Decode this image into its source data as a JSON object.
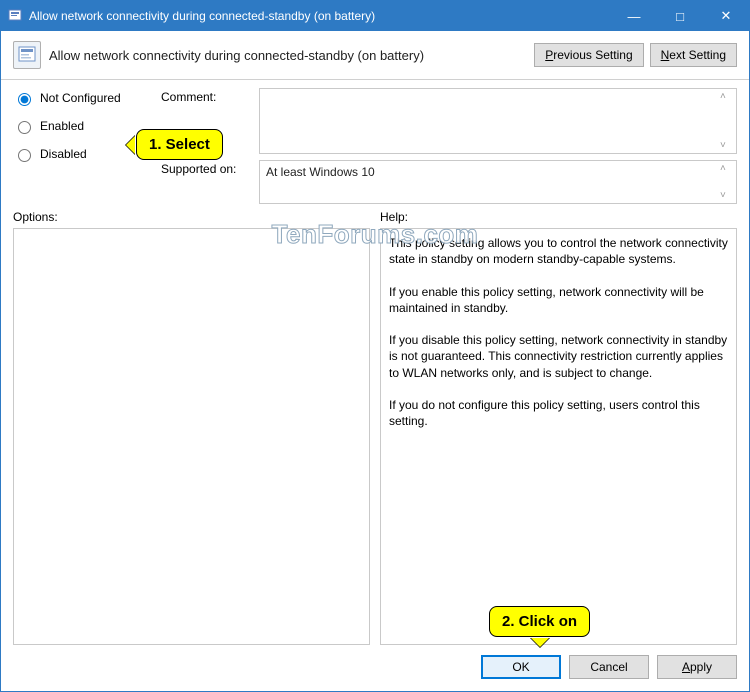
{
  "window": {
    "title": "Allow network connectivity during connected-standby (on battery)",
    "controls": {
      "min": "—",
      "max": "□",
      "close": "✕"
    }
  },
  "header": {
    "title": "Allow network connectivity during connected-standby (on battery)",
    "prev": "Previous Setting",
    "next": "Next Setting"
  },
  "radios": {
    "not_configured": "Not Configured",
    "enabled": "Enabled",
    "disabled": "Disabled"
  },
  "labels": {
    "comment": "Comment:",
    "supported": "Supported on:",
    "options": "Options:",
    "help": "Help:"
  },
  "supported_value": "At least Windows 10",
  "help_text": "This policy setting allows you to control the network connectivity state in standby on modern standby-capable systems.\n\nIf you enable this policy setting, network connectivity will be maintained in standby.\n\nIf you disable this policy setting, network connectivity in standby is not guaranteed. This connectivity restriction currently applies to WLAN networks only, and is subject to change.\n\nIf you do not configure this policy setting, users control this setting.",
  "footer": {
    "ok": "OK",
    "cancel": "Cancel",
    "apply": "Apply"
  },
  "annotations": {
    "select": "1. Select",
    "click": "2. Click on"
  },
  "watermark": "TenForums.com",
  "scroll": {
    "up": "˄",
    "down": "˅"
  }
}
